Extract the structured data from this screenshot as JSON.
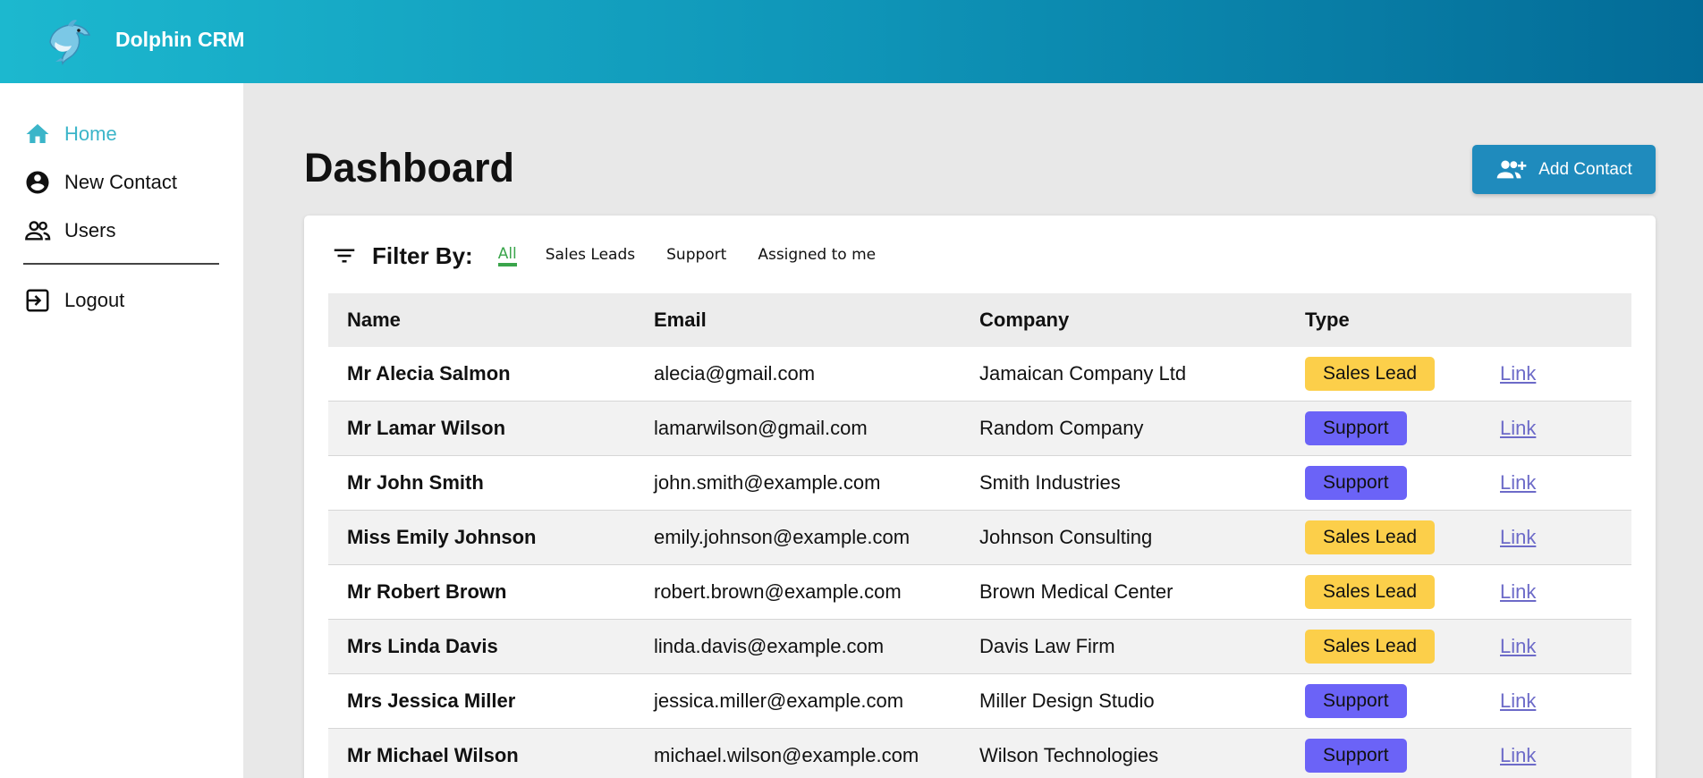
{
  "app": {
    "title": "Dolphin CRM"
  },
  "sidebar": {
    "items": [
      {
        "label": "Home",
        "icon": "home-icon"
      },
      {
        "label": "New Contact",
        "icon": "account-circle-icon"
      },
      {
        "label": "Users",
        "icon": "users-icon"
      },
      {
        "label": "Logout",
        "icon": "logout-icon"
      }
    ]
  },
  "main": {
    "title": "Dashboard",
    "add_contact_label": "Add Contact",
    "filter": {
      "label": "Filter By:",
      "options": [
        "All",
        "Sales Leads",
        "Support",
        "Assigned to me"
      ],
      "selected": "All"
    },
    "table": {
      "headers": [
        "Name",
        "Email",
        "Company",
        "Type"
      ],
      "link_label": "Link",
      "rows": [
        {
          "name": "Mr Alecia Salmon",
          "email": "alecia@gmail.com",
          "company": "Jamaican Company Ltd",
          "type": "Sales Lead"
        },
        {
          "name": "Mr Lamar Wilson",
          "email": "lamarwilson@gmail.com",
          "company": "Random Company",
          "type": "Support"
        },
        {
          "name": "Mr John Smith",
          "email": "john.smith@example.com",
          "company": "Smith Industries",
          "type": "Support"
        },
        {
          "name": "Miss Emily Johnson",
          "email": "emily.johnson@example.com",
          "company": "Johnson Consulting",
          "type": "Sales Lead"
        },
        {
          "name": "Mr Robert Brown",
          "email": "robert.brown@example.com",
          "company": "Brown Medical Center",
          "type": "Sales Lead"
        },
        {
          "name": "Mrs Linda Davis",
          "email": "linda.davis@example.com",
          "company": "Davis Law Firm",
          "type": "Sales Lead"
        },
        {
          "name": "Mrs Jessica Miller",
          "email": "jessica.miller@example.com",
          "company": "Miller Design Studio",
          "type": "Support"
        },
        {
          "name": "Mr Michael Wilson",
          "email": "michael.wilson@example.com",
          "company": "Wilson Technologies",
          "type": "Support"
        }
      ]
    }
  },
  "colors": {
    "header_gradient_start": "#1cb8cf",
    "header_gradient_end": "#036b97",
    "active_nav": "#3bb5c9",
    "primary_button": "#1f8bbd",
    "filter_active": "#3aa54b",
    "sales_lead_badge": "#fccf4a",
    "support_badge": "#6b63f7",
    "link": "#6c6ac8"
  }
}
